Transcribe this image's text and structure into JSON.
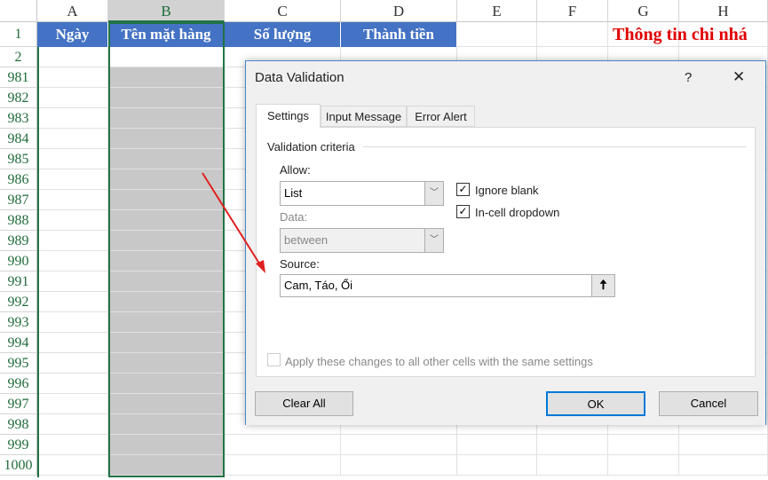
{
  "sheet": {
    "columns": [
      "A",
      "B",
      "C",
      "D",
      "E",
      "F",
      "G",
      "H"
    ],
    "selected_column": "B",
    "header_row": [
      "Ngày",
      "Tên mặt hàng",
      "Số lượng",
      "Thành tiền"
    ],
    "rows": [
      "1",
      "2",
      "981",
      "982",
      "983",
      "984",
      "985",
      "986",
      "987",
      "988",
      "989",
      "990",
      "991",
      "992",
      "993",
      "994",
      "995",
      "996",
      "997",
      "998",
      "999",
      "1000"
    ],
    "title_text": "Thông tin chi nhá",
    "header_color": "#4472c4",
    "title_color": "#e00000"
  },
  "dialog": {
    "title": "Data Validation",
    "help": "?",
    "close": "✕",
    "tabs": [
      "Settings",
      "Input Message",
      "Error Alert"
    ],
    "active_tab": "Settings",
    "section": "Validation criteria",
    "allow_label": "Allow:",
    "allow_value": "List",
    "data_label": "Data:",
    "data_value": "between",
    "ignore_blank": {
      "label": "Ignore blank",
      "checked": true
    },
    "in_cell_dropdown": {
      "label": "In-cell dropdown",
      "checked": true
    },
    "source_label": "Source:",
    "source_value": "Cam, Táo, Ổi",
    "apply_all": {
      "label": "Apply these changes to all other cells with the same settings",
      "checked": false
    },
    "clear_all": "Clear All",
    "ok": "OK",
    "cancel": "Cancel"
  }
}
